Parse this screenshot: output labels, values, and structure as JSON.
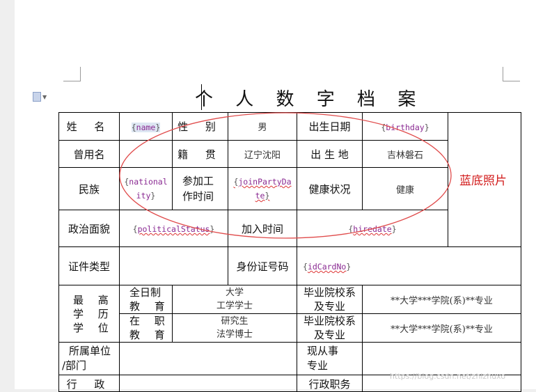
{
  "document": {
    "title": "个 人 数 字 档 案",
    "photo_note": "蓝底照片",
    "watermark": "https://blog.csdn.net/zhizhuxo",
    "annotation_color": "#d21c1c"
  },
  "rows": {
    "r1": {
      "name_label": "姓 名",
      "name_field": "name",
      "gender_label": "性 别",
      "gender_value": "男",
      "birthdate_label": "出生日期",
      "birthdate_field": "birthday"
    },
    "r2": {
      "former_name_label": "曾用名",
      "native_place_label": "籍 贯",
      "native_place_value": "辽宁沈阳",
      "birthplace_label": "出 生 地",
      "birthplace_value": "吉林磐石"
    },
    "r3": {
      "ethnicity_label": "民族",
      "nationality_field_a": "national",
      "nationality_field_b": "ity",
      "work_start_label_a": "参加工",
      "work_start_label_b": "作时间",
      "join_party_field_a": "joinPartyDa",
      "join_party_field_b": "te",
      "health_label": "健康状况",
      "health_value": "健康"
    },
    "r4": {
      "political_label": "政治面貌",
      "political_field": "politicalStatus",
      "join_date_label": "加入时间",
      "hire_field": "hiredate"
    },
    "r5": {
      "id_type_label": "证件类型",
      "id_no_label": "身份证号码",
      "id_field": "idCardNo"
    },
    "education": {
      "group_label_1": "最 高",
      "group_label_2": "学 历",
      "group_label_3": "学 位",
      "fulltime_label_a": "全日制",
      "fulltime_label_b": "教 育",
      "fulltime_degree_a": "大学",
      "fulltime_degree_b": "工学学士",
      "school_label_a": "毕业院校系",
      "school_label_b": "及专业",
      "fulltime_school": "**大学***学院(系)**专业",
      "onjob_label_a": "在 职",
      "onjob_label_b": "教 育",
      "onjob_degree_a": "研究生",
      "onjob_degree_b": "法学博士",
      "onjob_school_label_a": "毕业院校系",
      "onjob_school_label_b": "及专业",
      "onjob_school": "**大学***学院(系)**专业"
    },
    "r8": {
      "unit_label_a": "所属单位",
      "unit_label_b": "/部门",
      "profession_label_a": "现从事",
      "profession_label_b": "专业"
    },
    "r9": {
      "admin_label": "行 政",
      "admin_duty_label": "行政职务"
    }
  }
}
